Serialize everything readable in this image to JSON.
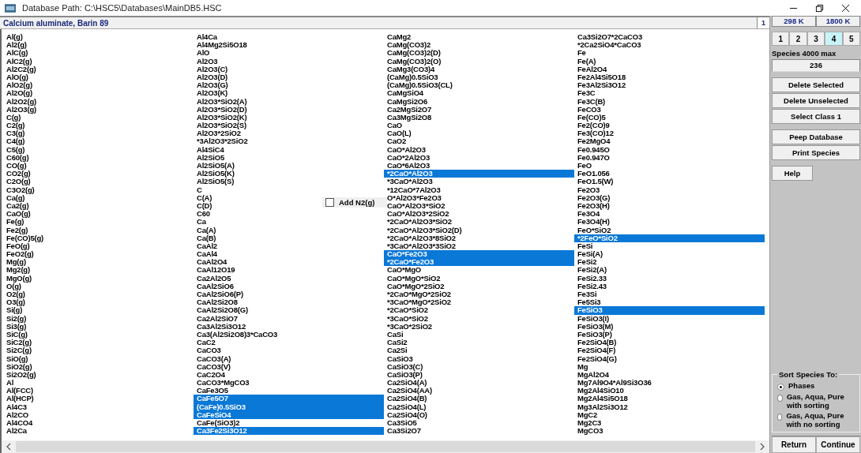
{
  "window": {
    "title": "Database Path: C:\\HSC5\\Databases\\MainDB5.HSC"
  },
  "header": {
    "title": "Calcium aluminate, Barin 89",
    "page": "1"
  },
  "columns": [
    {
      "items": [
        {
          "name": "Al(g)",
          "selected": false
        },
        {
          "name": "Al2(g)",
          "selected": false
        },
        {
          "name": "AlC(g)",
          "selected": false
        },
        {
          "name": "AlC2(g)",
          "selected": false
        },
        {
          "name": "Al2C2(g)",
          "selected": false
        },
        {
          "name": "AlO(g)",
          "selected": false
        },
        {
          "name": "AlO2(g)",
          "selected": false
        },
        {
          "name": "Al2O(g)",
          "selected": false
        },
        {
          "name": "Al2O2(g)",
          "selected": false
        },
        {
          "name": "Al2O3(g)",
          "selected": false
        },
        {
          "name": "C(g)",
          "selected": false
        },
        {
          "name": "C2(g)",
          "selected": false
        },
        {
          "name": "C3(g)",
          "selected": false
        },
        {
          "name": "C4(g)",
          "selected": false
        },
        {
          "name": "C5(g)",
          "selected": false
        },
        {
          "name": "C60(g)",
          "selected": false
        },
        {
          "name": "CO(g)",
          "selected": false
        },
        {
          "name": "CO2(g)",
          "selected": false
        },
        {
          "name": "C2O(g)",
          "selected": false
        },
        {
          "name": "C3O2(g)",
          "selected": false
        },
        {
          "name": "Ca(g)",
          "selected": false
        },
        {
          "name": "Ca2(g)",
          "selected": false
        },
        {
          "name": "CaO(g)",
          "selected": false
        },
        {
          "name": "Fe(g)",
          "selected": false
        },
        {
          "name": "Fe2(g)",
          "selected": false
        },
        {
          "name": "Fe(CO)5(g)",
          "selected": false
        },
        {
          "name": "FeO(g)",
          "selected": false
        },
        {
          "name": "FeO2(g)",
          "selected": false
        },
        {
          "name": "Mg(g)",
          "selected": false
        },
        {
          "name": "Mg2(g)",
          "selected": false
        },
        {
          "name": "MgO(g)",
          "selected": false
        },
        {
          "name": "O(g)",
          "selected": false
        },
        {
          "name": "O2(g)",
          "selected": false
        },
        {
          "name": "O3(g)",
          "selected": false
        },
        {
          "name": "Si(g)",
          "selected": false
        },
        {
          "name": "Si2(g)",
          "selected": false
        },
        {
          "name": "Si3(g)",
          "selected": false
        },
        {
          "name": "SiC(g)",
          "selected": false
        },
        {
          "name": "SiC2(g)",
          "selected": false
        },
        {
          "name": "Si2C(g)",
          "selected": false
        },
        {
          "name": "SiO(g)",
          "selected": false
        },
        {
          "name": "SiO2(g)",
          "selected": false
        },
        {
          "name": "Si2O2(g)",
          "selected": false
        },
        {
          "name": "Al",
          "selected": false
        },
        {
          "name": "Al(FCC)",
          "selected": false
        },
        {
          "name": "Al(HCP)",
          "selected": false
        },
        {
          "name": "Al4C3",
          "selected": false
        },
        {
          "name": "Al2CO",
          "selected": false
        },
        {
          "name": "Al4CO4",
          "selected": false
        },
        {
          "name": "Al2Ca",
          "selected": false
        }
      ]
    },
    {
      "items": [
        {
          "name": "Al4Ca",
          "selected": false
        },
        {
          "name": "Al4Mg2Si5O18",
          "selected": false
        },
        {
          "name": "AlO",
          "selected": false
        },
        {
          "name": "Al2O3",
          "selected": false
        },
        {
          "name": "Al2O3(C)",
          "selected": false
        },
        {
          "name": "Al2O3(D)",
          "selected": false
        },
        {
          "name": "Al2O3(G)",
          "selected": false
        },
        {
          "name": "Al2O3(K)",
          "selected": false
        },
        {
          "name": "Al2O3*SiO2(A)",
          "selected": false
        },
        {
          "name": "Al2O3*SiO2(D)",
          "selected": false
        },
        {
          "name": "Al2O3*SiO2(K)",
          "selected": false
        },
        {
          "name": "Al2O3*SiO2(S)",
          "selected": false
        },
        {
          "name": "Al2O3*2SiO2",
          "selected": false
        },
        {
          "name": "*3Al2O3*2SiO2",
          "selected": false
        },
        {
          "name": "Al4SiC4",
          "selected": false
        },
        {
          "name": "Al2SiO5",
          "selected": false
        },
        {
          "name": "Al2SiO5(A)",
          "selected": false
        },
        {
          "name": "Al2SiO5(K)",
          "selected": false
        },
        {
          "name": "Al2SiO5(S)",
          "selected": false
        },
        {
          "name": "C",
          "selected": false
        },
        {
          "name": "C(A)",
          "selected": false
        },
        {
          "name": "C(D)",
          "selected": false
        },
        {
          "name": "C60",
          "selected": false
        },
        {
          "name": "Ca",
          "selected": false
        },
        {
          "name": "Ca(A)",
          "selected": false
        },
        {
          "name": "Ca(B)",
          "selected": false
        },
        {
          "name": "CaAl2",
          "selected": false
        },
        {
          "name": "CaAl4",
          "selected": false
        },
        {
          "name": "CaAl2O4",
          "selected": false
        },
        {
          "name": "CaAl12O19",
          "selected": false
        },
        {
          "name": "Ca2Al2O5",
          "selected": false
        },
        {
          "name": "CaAl2SiO6",
          "selected": false
        },
        {
          "name": "CaAl2SiO6(P)",
          "selected": false
        },
        {
          "name": "CaAl2Si2O8",
          "selected": false
        },
        {
          "name": "CaAl2Si2O8(G)",
          "selected": false
        },
        {
          "name": "Ca2Al2SiO7",
          "selected": false
        },
        {
          "name": "Ca3Al2Si3O12",
          "selected": false
        },
        {
          "name": "Ca3(Al2Si2O8)3*CaCO3",
          "selected": false
        },
        {
          "name": "CaC2",
          "selected": false
        },
        {
          "name": "CaCO3",
          "selected": false
        },
        {
          "name": "CaCO3(A)",
          "selected": false
        },
        {
          "name": "CaCO3(V)",
          "selected": false
        },
        {
          "name": "CaC2O4",
          "selected": false
        },
        {
          "name": "CaCO3*MgCO3",
          "selected": false
        },
        {
          "name": "CaFe3O5",
          "selected": false
        },
        {
          "name": "CaFe5O7",
          "selected": true
        },
        {
          "name": "(CaFe)0.5SiO3",
          "selected": true
        },
        {
          "name": "CaFeSiO4",
          "selected": true
        },
        {
          "name": "CaFe(SiO3)2",
          "selected": false
        },
        {
          "name": "Ca3Fe2Si3O12",
          "selected": true
        }
      ]
    },
    {
      "items": [
        {
          "name": "CaMg2",
          "selected": false
        },
        {
          "name": "CaMg(CO3)2",
          "selected": false
        },
        {
          "name": "CaMg(CO3)2(D)",
          "selected": false
        },
        {
          "name": "CaMg(CO3)2(O)",
          "selected": false
        },
        {
          "name": "CaMg3(CO3)4",
          "selected": false
        },
        {
          "name": "(CaMg)0.5SiO3",
          "selected": false
        },
        {
          "name": "(CaMg)0.5SiO3(CL)",
          "selected": false
        },
        {
          "name": "CaMgSiO4",
          "selected": false
        },
        {
          "name": "CaMgSi2O6",
          "selected": false
        },
        {
          "name": "Ca2MgSi2O7",
          "selected": false
        },
        {
          "name": "Ca3MgSi2O8",
          "selected": false
        },
        {
          "name": "CaO",
          "selected": false
        },
        {
          "name": "CaO(L)",
          "selected": false
        },
        {
          "name": "CaO2",
          "selected": false
        },
        {
          "name": "CaO*Al2O3",
          "selected": false
        },
        {
          "name": "CaO*2Al2O3",
          "selected": false
        },
        {
          "name": "CaO*6Al2O3",
          "selected": false
        },
        {
          "name": "*2CaO*Al2O3",
          "selected": true
        },
        {
          "name": "*3CaO*Al2O3",
          "selected": false
        },
        {
          "name": "*12CaO*7Al2O3",
          "selected": false
        },
        {
          "name": "O*Al2O3*Fe2O3",
          "selected": false
        },
        {
          "name": "CaO*Al2O3*SiO2",
          "selected": false
        },
        {
          "name": "CaO*Al2O3*2SiO2",
          "selected": false
        },
        {
          "name": "*2CaO*Al2O3*SiO2",
          "selected": false
        },
        {
          "name": "*2CaO*Al2O3*SiO2(D)",
          "selected": false
        },
        {
          "name": "*2CaO*Al2O3*8SiO2",
          "selected": false
        },
        {
          "name": "*3CaO*Al2O3*3SiO2",
          "selected": false
        },
        {
          "name": "CaO*Fe2O3",
          "selected": true
        },
        {
          "name": "*2CaO*Fe2O3",
          "selected": true
        },
        {
          "name": "CaO*MgO",
          "selected": false
        },
        {
          "name": "CaO*MgO*SiO2",
          "selected": false
        },
        {
          "name": "CaO*MgO*2SiO2",
          "selected": false
        },
        {
          "name": "*2CaO*MgO*2SiO2",
          "selected": false
        },
        {
          "name": "*3CaO*MgO*2SiO2",
          "selected": false
        },
        {
          "name": "*2CaO*SiO2",
          "selected": false
        },
        {
          "name": "*3CaO*SiO2",
          "selected": false
        },
        {
          "name": "*3CaO*2SiO2",
          "selected": false
        },
        {
          "name": "CaSi",
          "selected": false
        },
        {
          "name": "CaSi2",
          "selected": false
        },
        {
          "name": "Ca2Si",
          "selected": false
        },
        {
          "name": "CaSiO3",
          "selected": false
        },
        {
          "name": "CaSiO3(C)",
          "selected": false
        },
        {
          "name": "CaSiO3(P)",
          "selected": false
        },
        {
          "name": "Ca2SiO4(A)",
          "selected": false
        },
        {
          "name": "Ca2SiO4(AA)",
          "selected": false
        },
        {
          "name": "Ca2SiO4(B)",
          "selected": false
        },
        {
          "name": "Ca2SiO4(L)",
          "selected": false
        },
        {
          "name": "Ca2SiO4(O)",
          "selected": false
        },
        {
          "name": "Ca3SiO5",
          "selected": false
        },
        {
          "name": "Ca3Si2O7",
          "selected": false
        }
      ]
    },
    {
      "items": [
        {
          "name": "Ca3Si2O7*2CaCO3",
          "selected": false
        },
        {
          "name": "*2Ca2SiO4*CaCO3",
          "selected": false
        },
        {
          "name": "Fe",
          "selected": false
        },
        {
          "name": "Fe(A)",
          "selected": false
        },
        {
          "name": "FeAl2O4",
          "selected": false
        },
        {
          "name": "Fe2Al4Si5O18",
          "selected": false
        },
        {
          "name": "Fe3Al2Si3O12",
          "selected": false
        },
        {
          "name": "Fe3C",
          "selected": false
        },
        {
          "name": "Fe3C(B)",
          "selected": false
        },
        {
          "name": "FeCO3",
          "selected": false
        },
        {
          "name": "Fe(CO)5",
          "selected": false
        },
        {
          "name": "Fe2(CO)9",
          "selected": false
        },
        {
          "name": "Fe3(CO)12",
          "selected": false
        },
        {
          "name": "Fe2MgO4",
          "selected": false
        },
        {
          "name": "Fe0.945O",
          "selected": false
        },
        {
          "name": "Fe0.947O",
          "selected": false
        },
        {
          "name": "FeO",
          "selected": false
        },
        {
          "name": "FeO1.056",
          "selected": false
        },
        {
          "name": "FeO1.5(W)",
          "selected": false
        },
        {
          "name": "Fe2O3",
          "selected": false
        },
        {
          "name": "Fe2O3(G)",
          "selected": false
        },
        {
          "name": "Fe2O3(H)",
          "selected": false
        },
        {
          "name": "Fe3O4",
          "selected": false
        },
        {
          "name": "Fe3O4(H)",
          "selected": false
        },
        {
          "name": "FeO*SiO2",
          "selected": false
        },
        {
          "name": "*2FeO*SiO2",
          "selected": true
        },
        {
          "name": "FeSi",
          "selected": false
        },
        {
          "name": "FeSi(A)",
          "selected": false
        },
        {
          "name": "FeSi2",
          "selected": false
        },
        {
          "name": "FeSi2(A)",
          "selected": false
        },
        {
          "name": "FeSi2.33",
          "selected": false
        },
        {
          "name": "FeSi2.43",
          "selected": false
        },
        {
          "name": "Fe3Si",
          "selected": false
        },
        {
          "name": "Fe5Si3",
          "selected": false
        },
        {
          "name": "FeSiO3",
          "selected": true
        },
        {
          "name": "FeSiO3(I)",
          "selected": false
        },
        {
          "name": "FeSiO3(M)",
          "selected": false
        },
        {
          "name": "FeSiO3(P)",
          "selected": false
        },
        {
          "name": "Fe2SiO4(B)",
          "selected": false
        },
        {
          "name": "Fe2SiO4(F)",
          "selected": false
        },
        {
          "name": "Fe2SiO4(G)",
          "selected": false
        },
        {
          "name": "Mg",
          "selected": false
        },
        {
          "name": "MgAl2O4",
          "selected": false
        },
        {
          "name": "Mg7Al9O4*Al9Si3O36",
          "selected": false
        },
        {
          "name": "Mg2Al4SiO10",
          "selected": false
        },
        {
          "name": "Mg2Al4Si5O18",
          "selected": false
        },
        {
          "name": "Mg3Al2Si3O12",
          "selected": false
        },
        {
          "name": "MgC2",
          "selected": false
        },
        {
          "name": "Mg2C3",
          "selected": false
        },
        {
          "name": "MgCO3",
          "selected": false
        }
      ]
    }
  ],
  "add_gas": {
    "label": "Add N2(g)",
    "checked": false
  },
  "temperatures": [
    "298 K",
    "1800 K"
  ],
  "tabs": [
    {
      "label": "1",
      "selected": false
    },
    {
      "label": "2",
      "selected": false
    },
    {
      "label": "3",
      "selected": false
    },
    {
      "label": "4",
      "selected": true
    },
    {
      "label": "5",
      "selected": false
    }
  ],
  "species": {
    "label": "Species 4000 max",
    "value": "236"
  },
  "button_groups": [
    [
      "Delete Selected",
      "Delete Unselected",
      "Select Class 1"
    ],
    [
      "Peep Database",
      "Print Species"
    ],
    [
      "Help"
    ]
  ],
  "sort": {
    "title": "Sort Species To:",
    "options": [
      {
        "label": "Phases",
        "selected": true
      },
      {
        "label": "Gas, Aqua, Pure with sorting",
        "selected": false
      },
      {
        "label": "Gas, Aqua, Pure with no sorting",
        "selected": false
      }
    ]
  },
  "footer_buttons": [
    "Return",
    "Continue"
  ]
}
